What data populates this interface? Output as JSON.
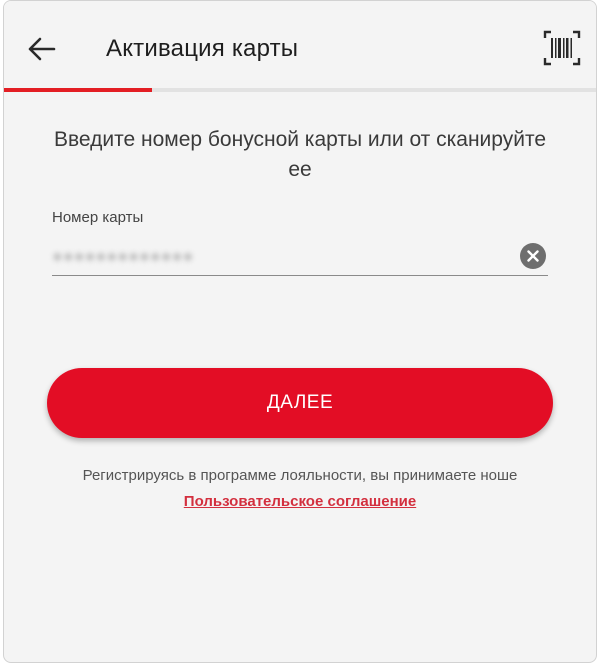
{
  "colors": {
    "accent": "#e30d25",
    "background": "#f4f4f4",
    "link": "#d32f3e"
  },
  "header": {
    "title": "Активация карты",
    "back_icon": "arrow-left-icon",
    "scan_icon": "barcode-scan-icon",
    "progress_fraction": 0.25
  },
  "main": {
    "instruction": "Введите номер бонусной карты или от сканируйте ее",
    "card_field": {
      "label": "Номер карты",
      "value": "●●●●●●●●●●●●●",
      "clear_icon": "clear-circle-icon"
    },
    "next_label": "ДАЛЕЕ",
    "terms_text": "Регистрируясь в программе лояльности, вы принимаете ноше",
    "terms_link": "Пользовательское соглашение"
  }
}
